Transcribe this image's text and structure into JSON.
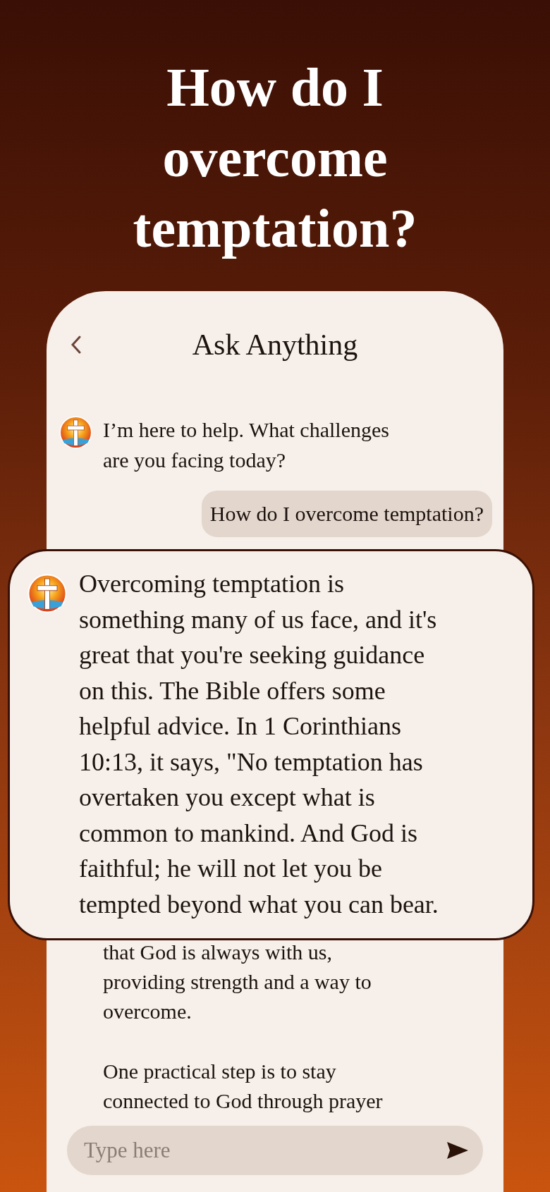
{
  "headline": "How do I overcome temptation?",
  "chat_screen": {
    "title": "Ask Anything",
    "messages": [
      {
        "kind": "bot",
        "lines": [
          "I’m here to help. What challenges",
          "are you facing today?"
        ]
      },
      {
        "kind": "user",
        "lines": [
          "How do I overcome temptation?"
        ]
      },
      {
        "kind": "bot_continued",
        "paragraphs": [
          [
            "that God is always with us,",
            "providing strength and a way to",
            "overcome."
          ],
          [
            "One practical step is to stay",
            "connected to God through prayer"
          ]
        ]
      }
    ],
    "input": {
      "placeholder": "Type here"
    }
  },
  "highlighted_reply": {
    "lines": [
      "Overcoming temptation is",
      "something many of us face, and it's",
      "great that you're seeking guidance",
      "on this. The Bible offers some",
      "helpful advice. In 1 Corinthians",
      "10:13, it says, \"No temptation has",
      "overtaken you except what is",
      "common to mankind. And God is",
      "faithful; he will not let you be",
      "tempted beyond what you can bear."
    ]
  }
}
